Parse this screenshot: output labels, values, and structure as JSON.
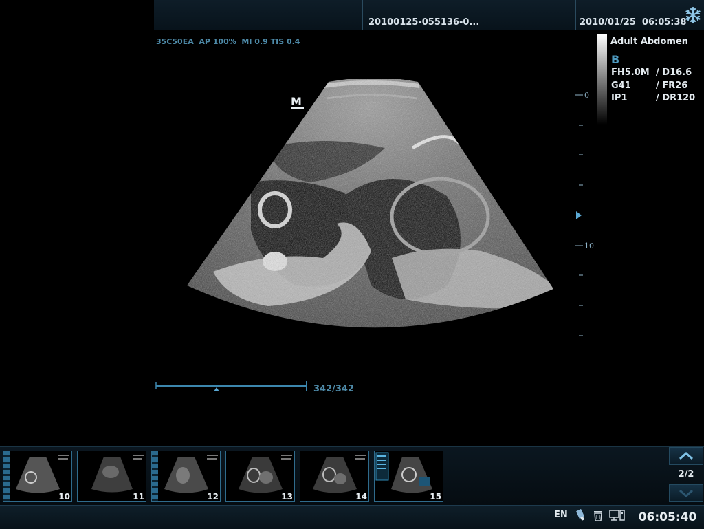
{
  "header": {
    "patient_id": "20100125-055136-0...",
    "datetime": "2010/01/25  06:05:38",
    "freeze_icon": "snowflake-icon"
  },
  "probe_info": "35C50EA  AP 100%  MI 0.9 TIS 0.4",
  "exam": {
    "preset": "Adult Abdomen",
    "mode": "B",
    "params": [
      {
        "left": "FH5.0M",
        "right": "/ D16.6"
      },
      {
        "left": "G41",
        "right": "/ FR26"
      },
      {
        "left": "IP1",
        "right": "/ DR120"
      }
    ]
  },
  "depth_scale": {
    "labels": [
      "0",
      "10"
    ]
  },
  "marker": "M",
  "cine": {
    "frame_count": "342/342"
  },
  "thumbnails": [
    {
      "num": "10"
    },
    {
      "num": "11"
    },
    {
      "num": "12"
    },
    {
      "num": "13"
    },
    {
      "num": "14"
    },
    {
      "num": "15"
    }
  ],
  "pager": {
    "page": "2/2"
  },
  "status": {
    "language": "EN",
    "time": "06:05:40"
  },
  "colors": {
    "accent": "#4e9ac0",
    "border": "#2f6b8c"
  }
}
